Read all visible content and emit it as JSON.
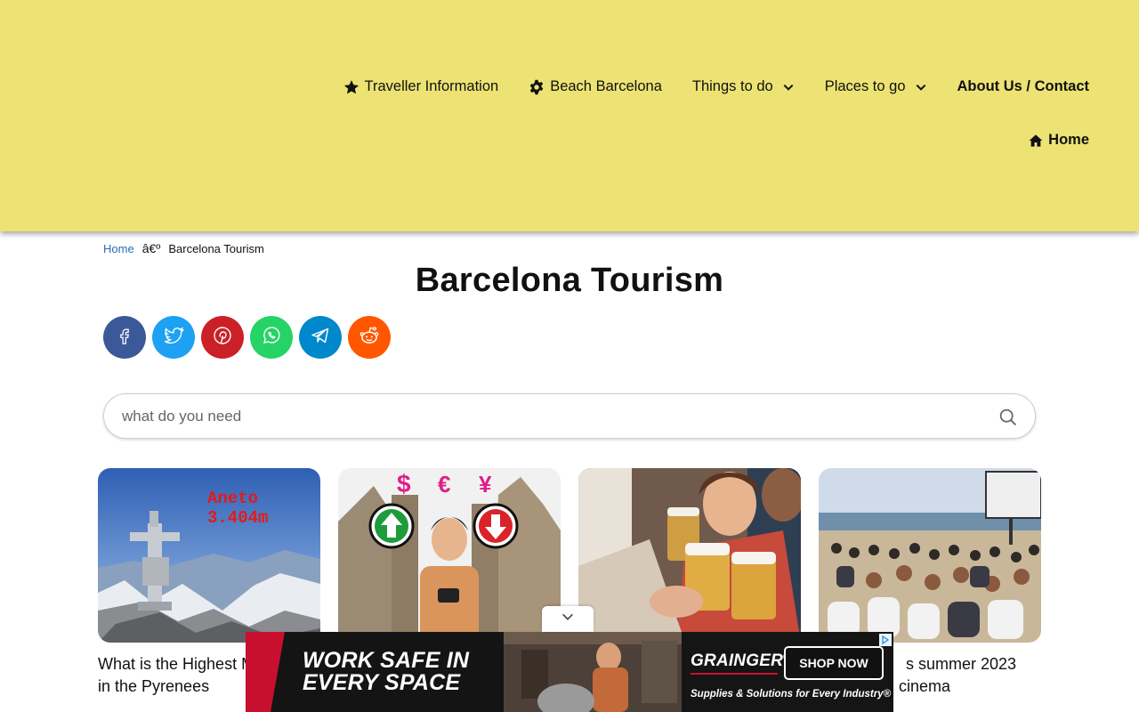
{
  "header": {
    "nav": [
      {
        "label": "Traveller Information",
        "icon": "star-icon"
      },
      {
        "label": "Beach Barcelona",
        "icon": "gear-icon"
      },
      {
        "label": "Things to do",
        "icon": "chevron-down-icon"
      },
      {
        "label": "Places to go",
        "icon": "chevron-down-icon"
      },
      {
        "label": "About Us / Contact"
      }
    ],
    "home_label": "Home",
    "background": "#ede274"
  },
  "breadcrumb": {
    "home": "Home",
    "separator": "â€º",
    "current": "Barcelona Tourism"
  },
  "page": {
    "title": "Barcelona Tourism"
  },
  "social": [
    {
      "name": "facebook",
      "color": "#3b5998"
    },
    {
      "name": "twitter",
      "color": "#1da1f2"
    },
    {
      "name": "pinterest",
      "color": "#cb2027"
    },
    {
      "name": "whatsapp",
      "color": "#25d366"
    },
    {
      "name": "telegram",
      "color": "#0088cc"
    },
    {
      "name": "reddit",
      "color": "#ff5700"
    }
  ],
  "search": {
    "placeholder": "what do you need",
    "value": ""
  },
  "cards": [
    {
      "title": "What is the Highest M",
      "title_line2": "in the Pyrenees",
      "image_text": [
        "Aneto",
        "3.404m"
      ]
    },
    {
      "title": "",
      "title_line2": "",
      "image_text": [
        "$",
        "€",
        "¥"
      ]
    },
    {
      "title": "",
      "title_line2": "",
      "image_text": []
    },
    {
      "title": "s summer 2023",
      "title_line2": "cinema",
      "image_text": []
    }
  ],
  "ad": {
    "headline_1": "WORK SAFE IN",
    "headline_2": "EVERY SPACE",
    "brand": "GRAINGER",
    "brand_mark": "®",
    "cta": "SHOP NOW",
    "tagline": "Supplies & Solutions for Every Industry®"
  }
}
